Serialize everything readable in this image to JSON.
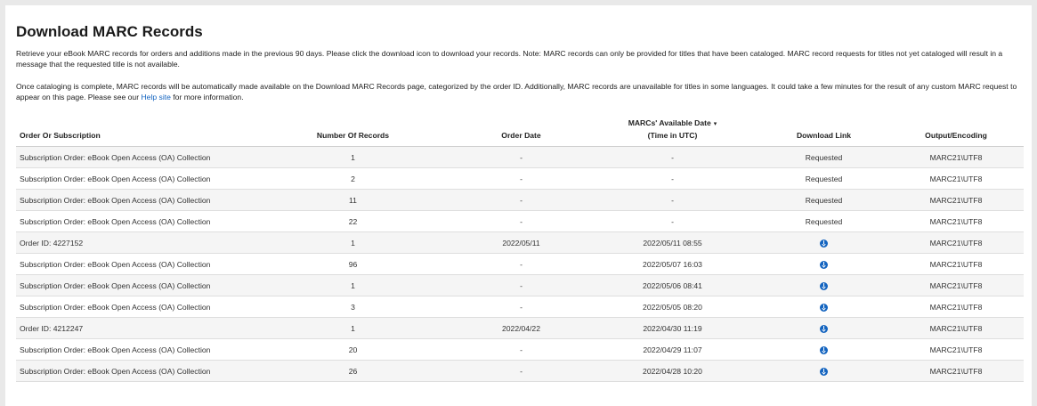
{
  "page": {
    "title": "Download MARC Records",
    "intro1": "Retrieve your eBook MARC records for orders and additions made in the previous 90 days. Please click the download icon to download your records. Note: MARC records can only be provided for titles that have been cataloged. MARC record requests for titles not yet cataloged will result in a message that the requested title is not available.",
    "intro2_before": "Once cataloging is complete, MARC records will be automatically made available on the Download MARC Records page, categorized by the order ID. Additionally, MARC records are unavailable for titles in some languages. It could take a few minutes for the result of any custom MARC request to appear on this page. Please see our ",
    "intro2_link": "Help site",
    "intro2_after": " for more information."
  },
  "table": {
    "headers": {
      "order": "Order Or Subscription",
      "records": "Number Of Records",
      "order_date": "Order Date",
      "available_line1": "MARCs' Available Date",
      "sort_caret": "▾",
      "available_line2": "(Time in UTC)",
      "download": "Download Link",
      "encoding": "Output/Encoding"
    },
    "rows": [
      {
        "order": "Subscription Order: eBook Open Access (OA) Collection",
        "records": "1",
        "order_date": "-",
        "available": "-",
        "download": "Requested",
        "encoding": "MARC21\\UTF8"
      },
      {
        "order": "Subscription Order: eBook Open Access (OA) Collection",
        "records": "2",
        "order_date": "-",
        "available": "-",
        "download": "Requested",
        "encoding": "MARC21\\UTF8"
      },
      {
        "order": "Subscription Order: eBook Open Access (OA) Collection",
        "records": "11",
        "order_date": "-",
        "available": "-",
        "download": "Requested",
        "encoding": "MARC21\\UTF8"
      },
      {
        "order": "Subscription Order: eBook Open Access (OA) Collection",
        "records": "22",
        "order_date": "-",
        "available": "-",
        "download": "Requested",
        "encoding": "MARC21\\UTF8"
      },
      {
        "order": "Order ID: 4227152",
        "records": "1",
        "order_date": "2022/05/11",
        "available": "2022/05/11 08:55",
        "download": "download-icon",
        "encoding": "MARC21\\UTF8"
      },
      {
        "order": "Subscription Order: eBook Open Access (OA) Collection",
        "records": "96",
        "order_date": "-",
        "available": "2022/05/07 16:03",
        "download": "download-icon",
        "encoding": "MARC21\\UTF8"
      },
      {
        "order": "Subscription Order: eBook Open Access (OA) Collection",
        "records": "1",
        "order_date": "-",
        "available": "2022/05/06 08:41",
        "download": "download-icon",
        "encoding": "MARC21\\UTF8"
      },
      {
        "order": "Subscription Order: eBook Open Access (OA) Collection",
        "records": "3",
        "order_date": "-",
        "available": "2022/05/05 08:20",
        "download": "download-icon",
        "encoding": "MARC21\\UTF8"
      },
      {
        "order": "Order ID: 4212247",
        "records": "1",
        "order_date": "2022/04/22",
        "available": "2022/04/30 11:19",
        "download": "download-icon",
        "encoding": "MARC21\\UTF8"
      },
      {
        "order": "Subscription Order: eBook Open Access (OA) Collection",
        "records": "20",
        "order_date": "-",
        "available": "2022/04/29 11:07",
        "download": "download-icon",
        "encoding": "MARC21\\UTF8"
      },
      {
        "order": "Subscription Order: eBook Open Access (OA) Collection",
        "records": "26",
        "order_date": "-",
        "available": "2022/04/28 10:20",
        "download": "download-icon",
        "encoding": "MARC21\\UTF8"
      }
    ]
  },
  "colors": {
    "accent": "#1565c0",
    "stripe": "#f5f5f5"
  }
}
